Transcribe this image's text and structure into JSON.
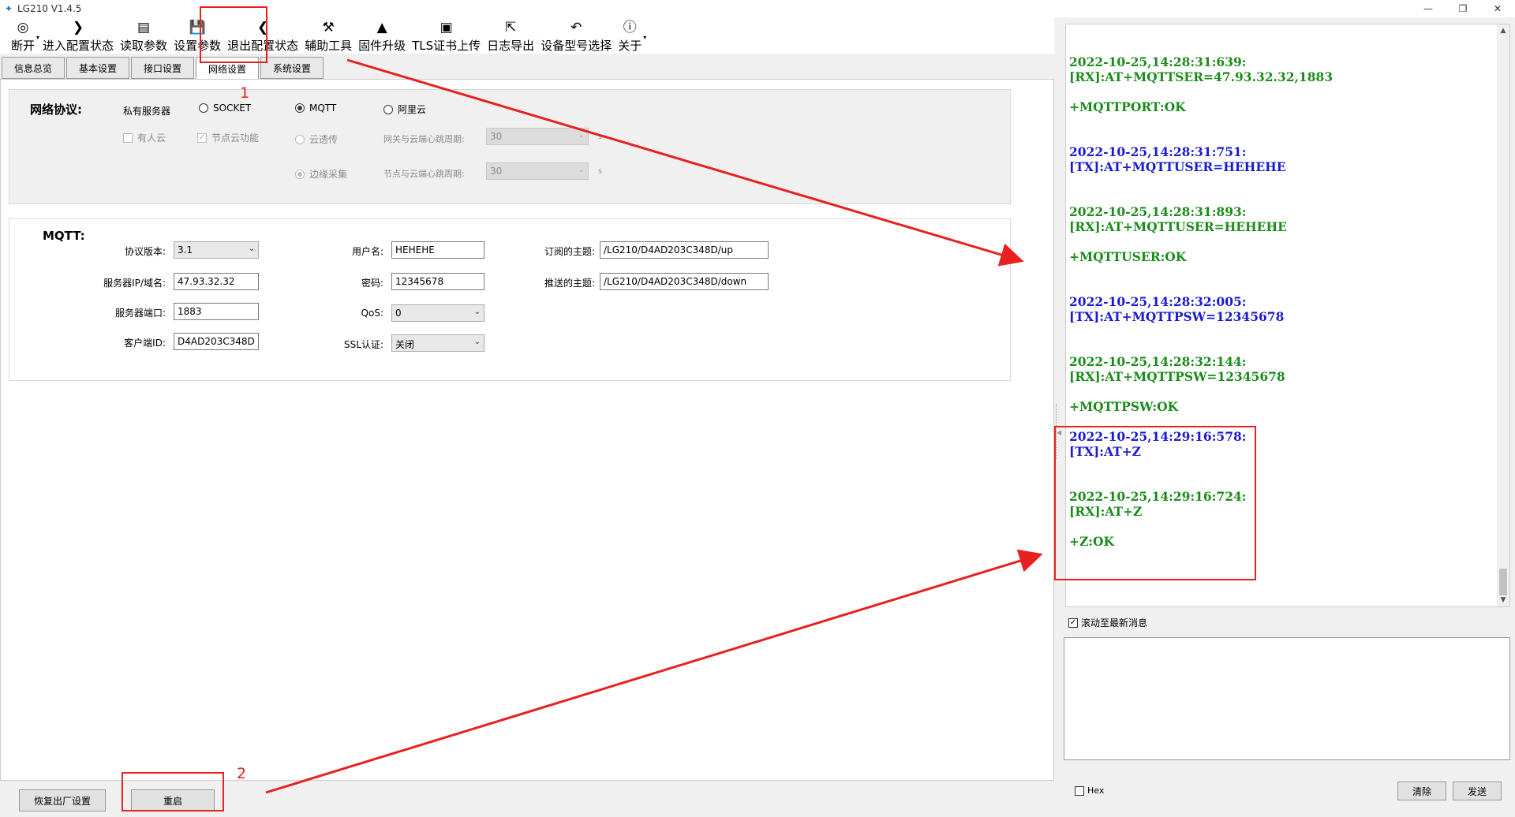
{
  "window": {
    "title": "LG210 V1.4.5",
    "controls": [
      "—",
      "❐",
      "✕"
    ]
  },
  "toolbar": {
    "items": [
      {
        "label": "断开",
        "icon": "disconnect-icon",
        "glyph": "◎"
      },
      {
        "label": "进入配置状态",
        "icon": "chevron-right-icon",
        "glyph": "❯"
      },
      {
        "label": "读取参数",
        "icon": "read-params-icon",
        "glyph": "▤"
      },
      {
        "label": "设置参数",
        "icon": "save-icon",
        "glyph": "💾"
      },
      {
        "label": "退出配置状态",
        "icon": "chevron-left-icon",
        "glyph": "❮"
      },
      {
        "label": "辅助工具",
        "icon": "toolbox-icon",
        "glyph": "⚒"
      },
      {
        "label": "固件升级",
        "icon": "rocket-icon",
        "glyph": "▲"
      },
      {
        "label": "TLS证书上传",
        "icon": "certificate-icon",
        "glyph": "▣"
      },
      {
        "label": "日志导出",
        "icon": "export-icon",
        "glyph": "⇱"
      },
      {
        "label": "设备型号选择",
        "icon": "undo-icon",
        "glyph": "↶"
      },
      {
        "label": "关于",
        "icon": "info-icon",
        "glyph": "ⓘ"
      }
    ],
    "dropdown_glyph": "▾"
  },
  "tabs": [
    {
      "label": "信息总览",
      "active": false
    },
    {
      "label": "基本设置",
      "active": false
    },
    {
      "label": "接口设置",
      "active": false
    },
    {
      "label": "网络设置",
      "active": true
    },
    {
      "label": "系统设置",
      "active": false
    }
  ],
  "network": {
    "title": "网络协议:",
    "private_server_label": "私有服务器",
    "socket_label": "SOCKET",
    "mqtt_label": "MQTT",
    "aliyun_label": "阿里云",
    "youren_label": "有人云",
    "node_cloud_label": "节点云功能",
    "cloud_trans_label": "云透传",
    "edge_collect_label": "边缘采集",
    "gw_heartbeat_label": "网关与云端心跳周期:",
    "gw_heartbeat_value": "30",
    "node_heartbeat_label": "节点与云端心跳周期:",
    "node_heartbeat_value": "30",
    "unit": "s",
    "selected": "MQTT"
  },
  "mqtt": {
    "title": "MQTT:",
    "version_label": "协议版本:",
    "version_value": "3.1",
    "server_label": "服务器IP/域名:",
    "server_value": "47.93.32.32",
    "port_label": "服务器端口:",
    "port_value": "1883",
    "client_id_label": "客户端ID:",
    "client_id_value": "D4AD203C348D",
    "username_label": "用户名:",
    "username_value": "HEHEHE",
    "password_label": "密码:",
    "password_value": "12345678",
    "qos_label": "QoS:",
    "qos_value": "0",
    "ssl_label": "SSL认证:",
    "ssl_value": "关闭",
    "sub_topic_label": "订阅的主题:",
    "sub_topic_value": "/LG210/D4AD203C348D/up",
    "pub_topic_label": "推送的主题:",
    "pub_topic_value": "/LG210/D4AD203C348D/down"
  },
  "bottom": {
    "factory_reset": "恢复出厂设置",
    "restart": "重启"
  },
  "log": {
    "entries": [
      {
        "ts": "2022-10-25,14:28:31:639:",
        "msg": "[RX]:AT+MQTTSER=47.93.32.32,1883",
        "dir": "rx",
        "extra": "+MQTTPORT:OK"
      },
      {
        "ts": "2022-10-25,14:28:31:751:",
        "msg": "[TX]:AT+MQTTUSER=HEHEHE",
        "dir": "tx",
        "extra": ""
      },
      {
        "ts": "2022-10-25,14:28:31:893:",
        "msg": "[RX]:AT+MQTTUSER=HEHEHE",
        "dir": "rx",
        "extra": "+MQTTUSER:OK"
      },
      {
        "ts": "2022-10-25,14:28:32:005:",
        "msg": "[TX]:AT+MQTTPSW=12345678",
        "dir": "tx",
        "extra": ""
      },
      {
        "ts": "2022-10-25,14:28:32:144:",
        "msg": "[RX]:AT+MQTTPSW=12345678",
        "dir": "rx",
        "extra": "+MQTTPSW:OK"
      },
      {
        "ts": "2022-10-25,14:29:16:578:",
        "msg": "[TX]:AT+Z",
        "dir": "tx",
        "extra": ""
      },
      {
        "ts": "2022-10-25,14:29:16:724:",
        "msg": "[RX]:AT+Z",
        "dir": "rx",
        "extra": "+Z:OK"
      }
    ],
    "autoscroll_label": "滚动至最新消息",
    "autoscroll_checked": true
  },
  "send": {
    "hex_label": "Hex",
    "clear_label": "清除",
    "send_label": "发送"
  },
  "annotations": {
    "label1": "1",
    "label2": "2",
    "color": "#e82020"
  },
  "colors": {
    "rx": "#1a8c1a",
    "tx": "#1a1ad2"
  }
}
